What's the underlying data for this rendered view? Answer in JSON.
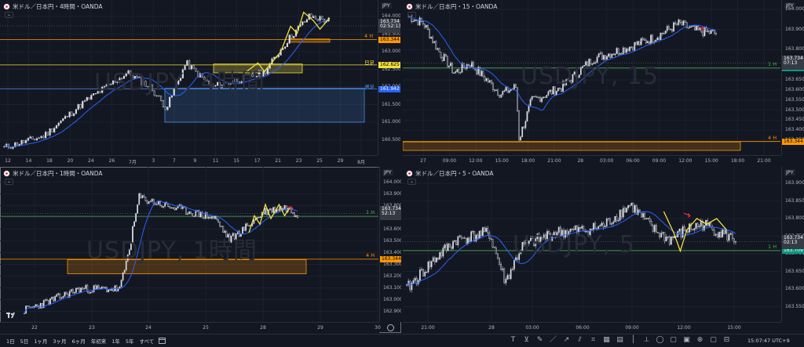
{
  "colors": {
    "bg": "#131722",
    "grid": "#1c2030",
    "up": "#d1d4dc",
    "down": "#d1d4dc",
    "ma": "#2962ff",
    "swing": "#f2e03b",
    "h4": "#ff9800",
    "h1": "#4caf50",
    "daily": "#f2e03b",
    "weekly": "#4a90e2",
    "red_arrow": "#f23645"
  },
  "panels": [
    {
      "id": "tl",
      "title": "米ドル／日本円・4時間・OANDA",
      "watermark": "USDJPY, 4時間",
      "symbol_box": "JPY",
      "price_tag": {
        "line1": "163.734",
        "line2": "02:52:13"
      },
      "levels": [
        {
          "label": "4 H",
          "tag": "163.344",
          "color": "orange"
        },
        {
          "label": "日足",
          "tag": "162.625",
          "color": "yellow"
        },
        {
          "label": "週足",
          "tag": "161.942",
          "color": "blue"
        }
      ],
      "yticks": [
        "164.000",
        "163.500",
        "163.000",
        "162.500",
        "162.000",
        "161.500",
        "161.000",
        "160.500"
      ],
      "xticks": [
        "12",
        "14",
        "18",
        "20",
        "24",
        "26",
        "7月",
        "3",
        "7",
        "9",
        "11",
        "15",
        "17",
        "21",
        "23",
        "25",
        "29",
        "8月"
      ],
      "price_range": [
        160.2,
        164.2
      ]
    },
    {
      "id": "tr",
      "title": "米ドル／日本円・15・OANDA",
      "watermark": "USDJPY, 15",
      "symbol_box": "JPY",
      "price_tag": {
        "line1": "163.734",
        "line2": "07:13"
      },
      "levels": [
        {
          "label": "1 H",
          "tag": "163.709",
          "color": "green"
        },
        {
          "label": "4 H",
          "tag": "163.344",
          "color": "orange"
        }
      ],
      "yticks": [
        "164.000",
        "163.900",
        "163.800",
        "163.700",
        "163.650",
        "163.600",
        "163.550",
        "163.500",
        "163.450",
        "163.400",
        "163.350"
      ],
      "xticks": [
        "27",
        "09:00",
        "12:00",
        "15:00",
        "18:00",
        "21:00",
        "28",
        "03:00",
        "06:00",
        "09:00",
        "12:00",
        "15:00",
        "18:00",
        "21:00"
      ],
      "price_range": [
        163.3,
        164.0
      ]
    },
    {
      "id": "bl",
      "title": "米ドル／日本円・1時間・OANDA",
      "watermark": "USDJPY, 1時間",
      "symbol_box": "JPY",
      "price_tag": {
        "line1": "163.734",
        "line2": "52:13"
      },
      "levels": [
        {
          "label": "1 H",
          "tag": "163.709",
          "color": "green"
        },
        {
          "label": "4 H",
          "tag": "163.344",
          "color": "orange"
        }
      ],
      "yticks": [
        "164.000",
        "163.900",
        "163.800",
        "163.700",
        "163.600",
        "163.500",
        "163.400",
        "163.300",
        "163.200",
        "163.100",
        "163.000",
        "162.900"
      ],
      "xticks": [
        "22",
        "23",
        "24",
        "25",
        "28",
        "29",
        "30"
      ],
      "price_range": [
        162.85,
        164.05
      ]
    },
    {
      "id": "br",
      "title": "米ドル／日本円・5・OANDA",
      "watermark": "USDJPY, 5",
      "symbol_box": "JPY",
      "price_tag": {
        "line1": "163.734",
        "line2": "02:13"
      },
      "levels": [
        {
          "label": "1 H",
          "tag": "163.709",
          "color": "green"
        }
      ],
      "yticks": [
        "163.900",
        "163.850",
        "163.800",
        "163.750",
        "163.700",
        "163.650",
        "163.600",
        "163.550"
      ],
      "xticks": [
        "21:00",
        "28",
        "03:00",
        "06:00",
        "09:00",
        "12:00",
        "15:00"
      ],
      "price_range": [
        163.52,
        163.92
      ]
    }
  ],
  "bottom": {
    "ranges": [
      "1日",
      "5日",
      "1ヶ月",
      "3ヶ月",
      "6ヶ月",
      "年初来",
      "1年",
      "5年",
      "すべて"
    ],
    "tools": [
      "text-tool-icon",
      "fib-tool-icon",
      "brush-tool-icon",
      "line-tool-icon",
      "ray-tool-icon",
      "pitchfork-tool-icon",
      "measure-tool-icon",
      "grid-tool-icon",
      "calc-tool-icon",
      "vline-tool-icon",
      "ruler-tool-icon",
      "circle-tool-icon",
      "frame-tool-icon",
      "frame2-tool-icon",
      "zoom-tool-icon",
      "box-tool-icon",
      "box2-tool-icon"
    ],
    "tool_glyphs": [
      "T",
      "⊻",
      "✎",
      "／",
      "↗",
      "⫽",
      "⌗",
      "▦",
      "▤",
      "│",
      "⟂",
      "◯",
      "▢",
      "▣",
      "⊕",
      "▢",
      "⊟"
    ],
    "clock": "15:07:47 UTC+9"
  }
}
